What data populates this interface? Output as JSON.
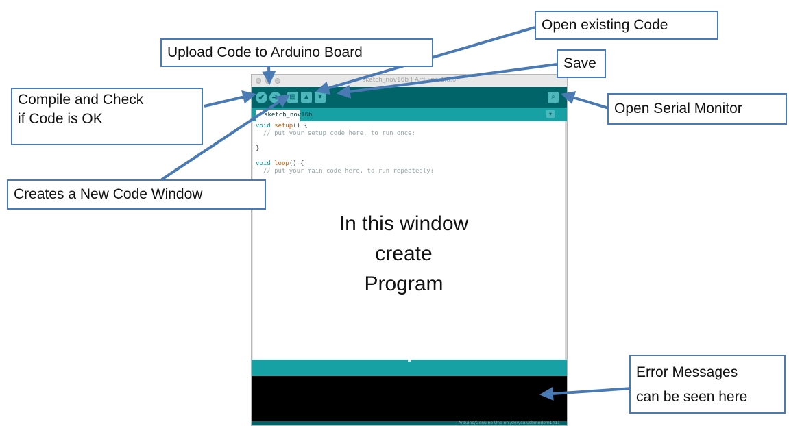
{
  "window": {
    "title": "sketch_nov16b | Arduino 1.8.0"
  },
  "toolbar": {
    "verify_icon": "✔",
    "upload_icon": "➜",
    "new_icon": "▤",
    "open_icon": "▲",
    "save_icon": "▼",
    "serial_monitor_icon": "⌕"
  },
  "tab": {
    "label": "sketch_nov16b",
    "menu_icon": "▾"
  },
  "code": {
    "l1_kw": "void",
    "l1_fn": "setup",
    "l1_rest": "() {",
    "l2": "  // put your setup code here, to run once:",
    "l3": "",
    "l4": "}",
    "l5": "",
    "l6_kw": "void",
    "l6_fn": "loop",
    "l6_rest": "() {",
    "l7": "  // put your main code here, to run repeatedly:"
  },
  "editor_overlay": {
    "line1": "In this window",
    "line2": "create",
    "line3": "Program"
  },
  "status": {
    "text": "Arduino/Genuino Uno on /dev/cu.usbmodem1411"
  },
  "callouts": {
    "compile": {
      "line1": "Compile and Check",
      "line2": "if Code is OK"
    },
    "upload": "Upload Code to Arduino Board",
    "open": "Open existing  Code",
    "save": "Save",
    "serial": "Open Serial Monitor",
    "new": "Creates a New Code Window",
    "errors": {
      "line1": "Error Messages",
      "line2": "can be seen here"
    }
  },
  "colors": {
    "toolbar": "#006468",
    "tabbar": "#17a1a5",
    "button": "#4db7bb",
    "console": "#000000",
    "callout_border": "#4a7ab3",
    "arrow": "#4a7ab3"
  }
}
